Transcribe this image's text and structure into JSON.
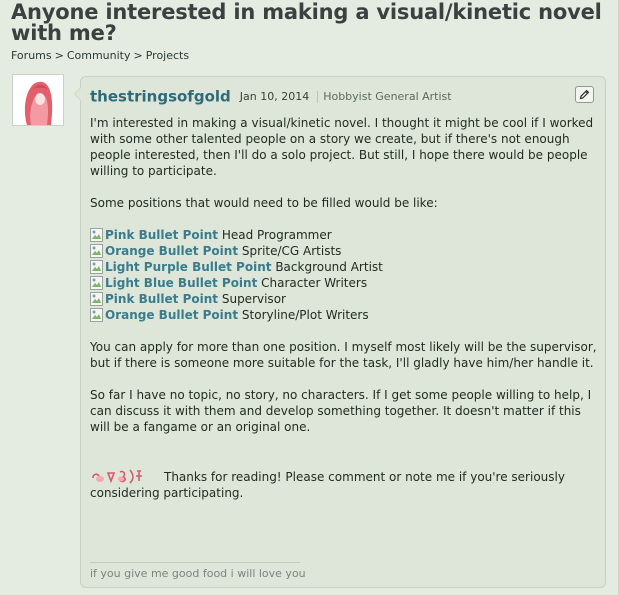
{
  "thread": {
    "title": "Anyone interested in making a visual/kinetic novel with me?"
  },
  "breadcrumb": {
    "items": [
      "Forums",
      "Community",
      "Projects"
    ],
    "separator": ">"
  },
  "post": {
    "author": "thestringsofgold",
    "date": "Jan 10, 2014",
    "user_title": "Hobbyist General Artist",
    "intro": "I'm interested in making a visual/kinetic novel. I thought it might be cool if I worked with some other talented people on a story we create, but if there's not enough people interested, then I'll do a solo project. But still, I hope there would be people willing to participate.",
    "positions_intro": "Some positions that would need to be filled would be like:",
    "positions": [
      {
        "bullet": "Pink Bullet Point",
        "role": "Head Programmer"
      },
      {
        "bullet": "Orange Bullet Point",
        "role": "Sprite/CG Artists"
      },
      {
        "bullet": "Light Purple Bullet Point",
        "role": "Background Artist"
      },
      {
        "bullet": "Light Blue Bullet Point",
        "role": "Character Writers"
      },
      {
        "bullet": "Pink Bullet Point",
        "role": "Supervisor"
      },
      {
        "bullet": "Orange Bullet Point",
        "role": "Storyline/Plot Writers"
      }
    ],
    "apply_text": "You can apply for more than one position. I myself most likely will be the supervisor, but if there is someone more suitable for the task, I'll gladly have him/her handle it.",
    "topic_text": "So far I have no topic, no story, no characters. If I get some people willing to help, I can discuss it with them and develop something together. It doesn't matter if this will be a fangame or an original one.",
    "closing": "Thanks for reading! Please comment or note me if you're seriously considering participating.",
    "closing_line1": "Thanks for reading! Please comment or note me if you're seriously",
    "closing_line2": "considering participating.",
    "signature": "if you give me good food i will love you"
  },
  "icons": {
    "edit": "pencil-icon",
    "bullet": "broken-image-icon",
    "emote": "blushing-emote-icon",
    "avatar": "user-avatar"
  },
  "colors": {
    "background": "#e4ebe0",
    "post_background": "#dde6d8",
    "username": "#2f6a7a",
    "bullet_label": "#3a7c8c",
    "title": "#3a4140"
  }
}
